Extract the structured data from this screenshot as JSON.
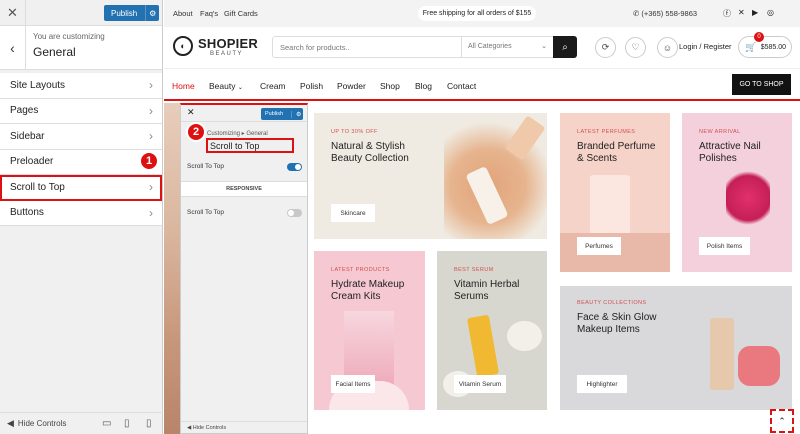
{
  "customizer": {
    "publish_label": "Publish",
    "you_are_customizing": "You are customizing",
    "section_title": "General",
    "items": [
      {
        "label": "Site Layouts"
      },
      {
        "label": "Pages"
      },
      {
        "label": "Sidebar"
      },
      {
        "label": "Preloader"
      },
      {
        "label": "Scroll to Top"
      },
      {
        "label": "Buttons"
      }
    ],
    "hide_controls": "Hide Controls",
    "step_badges": [
      "1",
      "2"
    ]
  },
  "site": {
    "topbar": {
      "links": [
        "About",
        "Faq's",
        "Gift Cards"
      ],
      "shipping": "Free shipping for all orders of $155",
      "phone": "(+365) 558-9863",
      "social_icons": [
        "facebook-icon",
        "x-icon",
        "youtube-icon",
        "instagram-icon"
      ]
    },
    "header": {
      "logo_main": "SHOPIER",
      "logo_sub": "BEAUTY",
      "search_placeholder": "Search for products..",
      "category_select": "All Categories",
      "login": "Login / Register",
      "cart_count": "0",
      "cart_total": "$585.00"
    },
    "nav": {
      "items": [
        "Home",
        "Beauty",
        "Cream",
        "Polish",
        "Powder",
        "Shop",
        "Blog",
        "Contact"
      ],
      "active": "Home",
      "cta": "GO TO SHOP"
    },
    "inner_panel": {
      "publish_label": "Publish",
      "breadcrumb": "Customizing ▸ General",
      "title": "Scroll to Top",
      "toggle1_label": "Scroll To Top",
      "responsive_label": "RESPONSIVE",
      "toggle2_label": "Scroll To Top",
      "hide_controls": "Hide Controls"
    },
    "banners": [
      {
        "tag": "UP TO 30% OFF",
        "title": "Natural & Stylish\nBeauty Collection",
        "button": "Skincare"
      },
      {
        "tag": "LATEST PERFUMES",
        "title": "Branded Perfume\n& Scents",
        "button": "Perfumes"
      },
      {
        "tag": "NEW ARRIVAL",
        "title": "Attractive Nail\nPolishes",
        "button": "Polish Items"
      },
      {
        "tag": "LATEST PRODUCTS",
        "title": "Hydrate Makeup\nCream Kits",
        "button": "Facial Items"
      },
      {
        "tag": "BEST SERUM",
        "title": "Vitamin Herbal\nSerums",
        "button": "Vitamin Serum"
      },
      {
        "tag": "BEAUTY COLLECTIONS",
        "title": "Face & Skin Glow\nMakeup Items",
        "button": "Highlighter"
      }
    ]
  },
  "colors": {
    "accent": "#d11111",
    "publish": "#2271b1",
    "dark": "#121212"
  }
}
